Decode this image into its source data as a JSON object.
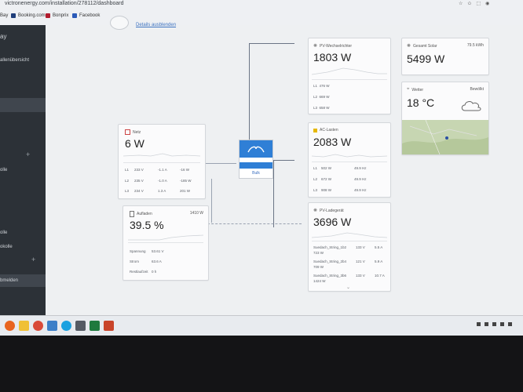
{
  "browser": {
    "url": "victronenergy.com/installation/278112/dashboard",
    "bookmarks": [
      "Bay",
      "Booking.com",
      "Bonprix",
      "Facebook"
    ]
  },
  "sidebar": {
    "items": [
      "ay",
      "allenübersicht",
      "olle",
      "olle",
      "okolle",
      "bmelden"
    ]
  },
  "header": {
    "hide_details": "Details ausblenden"
  },
  "netz": {
    "title": "Netz",
    "value": "6 W",
    "rows": [
      [
        "L1",
        "233 V",
        "-1.1 A",
        "-16 W"
      ],
      [
        "L2",
        "235 V",
        "-1.0 A",
        "-185 W"
      ],
      [
        "L3",
        "234 V",
        "1.3 A",
        "201 W"
      ]
    ]
  },
  "battery": {
    "title": "Aufladen",
    "power": "1410 W",
    "value": "39.5 %",
    "rows": [
      [
        "Spannung",
        "53.61 V"
      ],
      [
        "Strom",
        "63.6 A"
      ],
      [
        "Restlaufzeit",
        "0 h"
      ]
    ]
  },
  "inverter": {
    "label": "Bulk"
  },
  "pv_inverter": {
    "title": "PV-Wechselrichter",
    "value": "1803 W",
    "rows": [
      [
        "L1",
        "476 W"
      ],
      [
        "L2",
        "669 W"
      ],
      [
        "L3",
        "658 W"
      ]
    ]
  },
  "ac_loads": {
    "title": "AC-Lasten",
    "value": "2083 W",
    "rows": [
      [
        "L1",
        "502 W",
        "49.9 Hz"
      ],
      [
        "L2",
        "672 W",
        "49.9 Hz"
      ],
      [
        "L3",
        "908 W",
        "49.9 Hz"
      ]
    ]
  },
  "pv_charger": {
    "title": "PV-Ladegerät",
    "value": "3696 W",
    "rows": [
      [
        "Suedach_String_1b2",
        "133 V",
        "5.5 A",
        "723 W"
      ],
      [
        "Suedach_String_2b4",
        "121 V",
        "5.9 A",
        "709 W"
      ],
      [
        "Suedach_String_3b6",
        "133 V",
        "10.7 A",
        "1424 W"
      ]
    ]
  },
  "solar_total": {
    "title": "Gesamt Solar",
    "kwh": "79.5 kWh",
    "value": "5499 W"
  },
  "weather": {
    "title": "Wetter",
    "condition": "Bewölkt",
    "value": "18 °C"
  },
  "colors": {
    "accent": "#2f7fd6",
    "sidebar": "#2c3137"
  }
}
